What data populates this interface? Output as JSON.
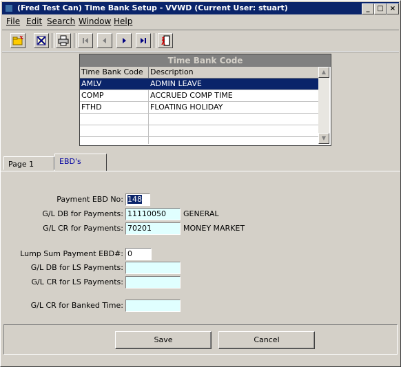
{
  "window": {
    "title": "(Fred Test Can) Time Bank Setup - VVWD (Current User: stuart)",
    "controls": [
      "_",
      "□",
      "×"
    ]
  },
  "menu": [
    {
      "label": "File",
      "key": "F"
    },
    {
      "label": "Edit",
      "key": "E"
    },
    {
      "label": "Search",
      "key": "S"
    },
    {
      "label": "Window",
      "key": "W"
    },
    {
      "label": "Help",
      "key": "H"
    }
  ],
  "toolbar": {
    "icons": [
      "new-folder-icon",
      "delete-icon",
      "print-icon",
      "first-record-icon",
      "previous-record-icon",
      "next-record-icon",
      "last-record-icon",
      "exit-icon"
    ]
  },
  "grid": {
    "caption": "Time Bank Code",
    "columns": [
      "Time Bank Code",
      "Description"
    ],
    "rows": [
      {
        "code": "AMLV",
        "description": "ADMIN LEAVE"
      },
      {
        "code": "COMP",
        "description": "ACCRUED COMP TIME"
      },
      {
        "code": "FTHD",
        "description": "FLOATING HOLIDAY"
      },
      {
        "code": "",
        "description": ""
      },
      {
        "code": "",
        "description": ""
      },
      {
        "code": "",
        "description": ""
      }
    ],
    "selected_row": 0
  },
  "tabs": [
    {
      "label": "Page 1"
    },
    {
      "label": "EBD's"
    }
  ],
  "form": {
    "payment_ebd_label": "Payment EBD No:",
    "payment_ebd_value": "148",
    "gl_db_payments_label": "G/L DB for Payments:",
    "gl_db_payments_value": "11110050",
    "gl_db_payments_desc": "GENERAL",
    "gl_cr_payments_label": "G/L CR for Payments:",
    "gl_cr_payments_value": "70201",
    "gl_cr_payments_desc": "MONEY MARKET",
    "lump_sum_label": "Lump Sum Payment EBD#:",
    "lump_sum_value": "0",
    "gl_db_ls_label": "G/L DB for LS Payments:",
    "gl_db_ls_value": "",
    "gl_cr_ls_label": "G/L CR for LS Payments:",
    "gl_cr_ls_value": "",
    "gl_cr_banked_label": "G/L CR for Banked Time:",
    "gl_cr_banked_value": ""
  },
  "buttons": {
    "save": "Save",
    "cancel": "Cancel"
  },
  "colors": {
    "titlebar": "#0a246a",
    "selection": "#0a246a",
    "field_bg": "#e0ffff",
    "face": "#d4d0c8"
  }
}
